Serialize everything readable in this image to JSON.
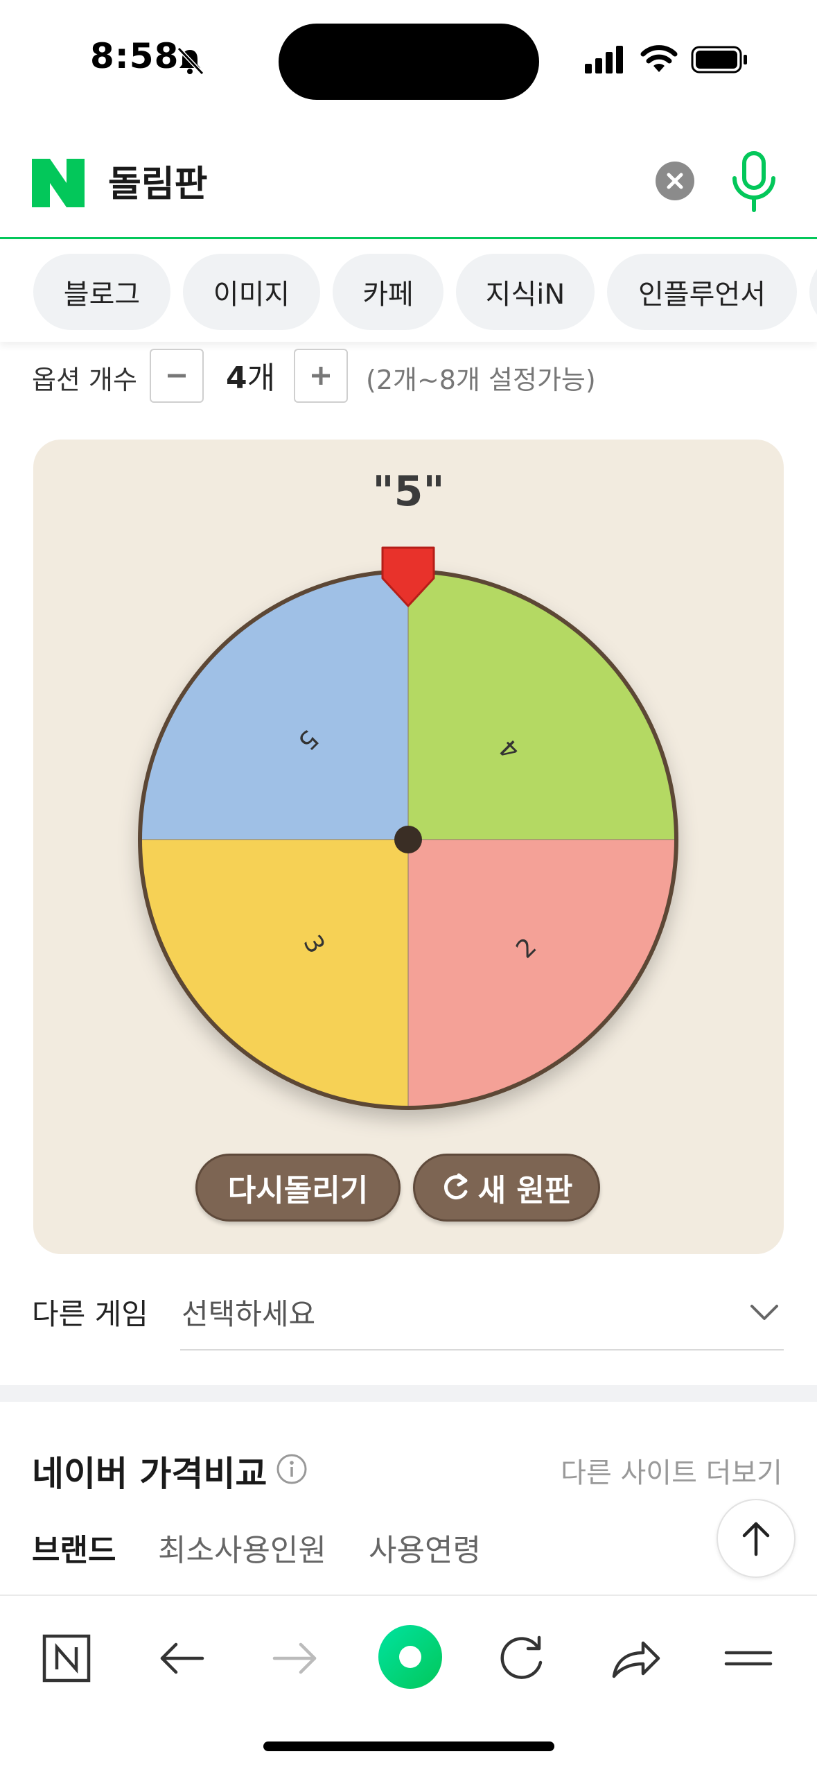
{
  "status_bar": {
    "time": "8:58"
  },
  "search": {
    "query": "돌림판"
  },
  "tabs": [
    {
      "label": "블로그"
    },
    {
      "label": "이미지"
    },
    {
      "label": "카페"
    },
    {
      "label": "지식iN"
    },
    {
      "label": "인플루언서"
    }
  ],
  "options": {
    "label": "옵션 개수",
    "count": "4",
    "unit": "개",
    "range_hint": "(2개~8개 설정가능)"
  },
  "wheel": {
    "result": "\"5\"",
    "segments": [
      {
        "label": "5",
        "color": "#9fc0e6"
      },
      {
        "label": "4",
        "color": "#b4d963"
      },
      {
        "label": "2",
        "color": "#f4a197"
      },
      {
        "label": "3",
        "color": "#f6d155"
      }
    ],
    "respin_label": "다시돌리기",
    "new_wheel_label": "새 원판"
  },
  "other_game": {
    "label": "다른 게임",
    "select_value": "선택하세요"
  },
  "price_compare": {
    "title": "네이버 가격비교",
    "more_sites": "다른 사이트 더보기",
    "filters": [
      "브랜드",
      "최소사용인원",
      "사용연령"
    ]
  },
  "colors": {
    "brand_green": "#03c75a",
    "card_bg": "#f2ebdf",
    "button_brown": "#7d6553",
    "pointer_red": "#e8322b"
  }
}
